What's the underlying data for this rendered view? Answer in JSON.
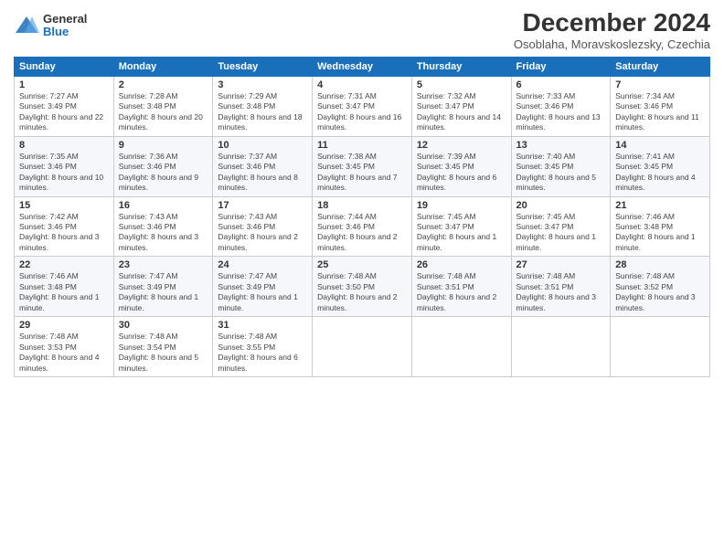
{
  "logo": {
    "general": "General",
    "blue": "Blue"
  },
  "header": {
    "title": "December 2024",
    "subtitle": "Osoblaha, Moravskoslezsky, Czechia"
  },
  "columns": [
    "Sunday",
    "Monday",
    "Tuesday",
    "Wednesday",
    "Thursday",
    "Friday",
    "Saturday"
  ],
  "weeks": [
    [
      {
        "day": "1",
        "sunrise": "Sunrise: 7:27 AM",
        "sunset": "Sunset: 3:49 PM",
        "daylight": "Daylight: 8 hours and 22 minutes."
      },
      {
        "day": "2",
        "sunrise": "Sunrise: 7:28 AM",
        "sunset": "Sunset: 3:48 PM",
        "daylight": "Daylight: 8 hours and 20 minutes."
      },
      {
        "day": "3",
        "sunrise": "Sunrise: 7:29 AM",
        "sunset": "Sunset: 3:48 PM",
        "daylight": "Daylight: 8 hours and 18 minutes."
      },
      {
        "day": "4",
        "sunrise": "Sunrise: 7:31 AM",
        "sunset": "Sunset: 3:47 PM",
        "daylight": "Daylight: 8 hours and 16 minutes."
      },
      {
        "day": "5",
        "sunrise": "Sunrise: 7:32 AM",
        "sunset": "Sunset: 3:47 PM",
        "daylight": "Daylight: 8 hours and 14 minutes."
      },
      {
        "day": "6",
        "sunrise": "Sunrise: 7:33 AM",
        "sunset": "Sunset: 3:46 PM",
        "daylight": "Daylight: 8 hours and 13 minutes."
      },
      {
        "day": "7",
        "sunrise": "Sunrise: 7:34 AM",
        "sunset": "Sunset: 3:46 PM",
        "daylight": "Daylight: 8 hours and 11 minutes."
      }
    ],
    [
      {
        "day": "8",
        "sunrise": "Sunrise: 7:35 AM",
        "sunset": "Sunset: 3:46 PM",
        "daylight": "Daylight: 8 hours and 10 minutes."
      },
      {
        "day": "9",
        "sunrise": "Sunrise: 7:36 AM",
        "sunset": "Sunset: 3:46 PM",
        "daylight": "Daylight: 8 hours and 9 minutes."
      },
      {
        "day": "10",
        "sunrise": "Sunrise: 7:37 AM",
        "sunset": "Sunset: 3:46 PM",
        "daylight": "Daylight: 8 hours and 8 minutes."
      },
      {
        "day": "11",
        "sunrise": "Sunrise: 7:38 AM",
        "sunset": "Sunset: 3:45 PM",
        "daylight": "Daylight: 8 hours and 7 minutes."
      },
      {
        "day": "12",
        "sunrise": "Sunrise: 7:39 AM",
        "sunset": "Sunset: 3:45 PM",
        "daylight": "Daylight: 8 hours and 6 minutes."
      },
      {
        "day": "13",
        "sunrise": "Sunrise: 7:40 AM",
        "sunset": "Sunset: 3:45 PM",
        "daylight": "Daylight: 8 hours and 5 minutes."
      },
      {
        "day": "14",
        "sunrise": "Sunrise: 7:41 AM",
        "sunset": "Sunset: 3:45 PM",
        "daylight": "Daylight: 8 hours and 4 minutes."
      }
    ],
    [
      {
        "day": "15",
        "sunrise": "Sunrise: 7:42 AM",
        "sunset": "Sunset: 3:46 PM",
        "daylight": "Daylight: 8 hours and 3 minutes."
      },
      {
        "day": "16",
        "sunrise": "Sunrise: 7:43 AM",
        "sunset": "Sunset: 3:46 PM",
        "daylight": "Daylight: 8 hours and 3 minutes."
      },
      {
        "day": "17",
        "sunrise": "Sunrise: 7:43 AM",
        "sunset": "Sunset: 3:46 PM",
        "daylight": "Daylight: 8 hours and 2 minutes."
      },
      {
        "day": "18",
        "sunrise": "Sunrise: 7:44 AM",
        "sunset": "Sunset: 3:46 PM",
        "daylight": "Daylight: 8 hours and 2 minutes."
      },
      {
        "day": "19",
        "sunrise": "Sunrise: 7:45 AM",
        "sunset": "Sunset: 3:47 PM",
        "daylight": "Daylight: 8 hours and 1 minute."
      },
      {
        "day": "20",
        "sunrise": "Sunrise: 7:45 AM",
        "sunset": "Sunset: 3:47 PM",
        "daylight": "Daylight: 8 hours and 1 minute."
      },
      {
        "day": "21",
        "sunrise": "Sunrise: 7:46 AM",
        "sunset": "Sunset: 3:48 PM",
        "daylight": "Daylight: 8 hours and 1 minute."
      }
    ],
    [
      {
        "day": "22",
        "sunrise": "Sunrise: 7:46 AM",
        "sunset": "Sunset: 3:48 PM",
        "daylight": "Daylight: 8 hours and 1 minute."
      },
      {
        "day": "23",
        "sunrise": "Sunrise: 7:47 AM",
        "sunset": "Sunset: 3:49 PM",
        "daylight": "Daylight: 8 hours and 1 minute."
      },
      {
        "day": "24",
        "sunrise": "Sunrise: 7:47 AM",
        "sunset": "Sunset: 3:49 PM",
        "daylight": "Daylight: 8 hours and 1 minute."
      },
      {
        "day": "25",
        "sunrise": "Sunrise: 7:48 AM",
        "sunset": "Sunset: 3:50 PM",
        "daylight": "Daylight: 8 hours and 2 minutes."
      },
      {
        "day": "26",
        "sunrise": "Sunrise: 7:48 AM",
        "sunset": "Sunset: 3:51 PM",
        "daylight": "Daylight: 8 hours and 2 minutes."
      },
      {
        "day": "27",
        "sunrise": "Sunrise: 7:48 AM",
        "sunset": "Sunset: 3:51 PM",
        "daylight": "Daylight: 8 hours and 3 minutes."
      },
      {
        "day": "28",
        "sunrise": "Sunrise: 7:48 AM",
        "sunset": "Sunset: 3:52 PM",
        "daylight": "Daylight: 8 hours and 3 minutes."
      }
    ],
    [
      {
        "day": "29",
        "sunrise": "Sunrise: 7:48 AM",
        "sunset": "Sunset: 3:53 PM",
        "daylight": "Daylight: 8 hours and 4 minutes."
      },
      {
        "day": "30",
        "sunrise": "Sunrise: 7:48 AM",
        "sunset": "Sunset: 3:54 PM",
        "daylight": "Daylight: 8 hours and 5 minutes."
      },
      {
        "day": "31",
        "sunrise": "Sunrise: 7:48 AM",
        "sunset": "Sunset: 3:55 PM",
        "daylight": "Daylight: 8 hours and 6 minutes."
      },
      null,
      null,
      null,
      null
    ]
  ]
}
